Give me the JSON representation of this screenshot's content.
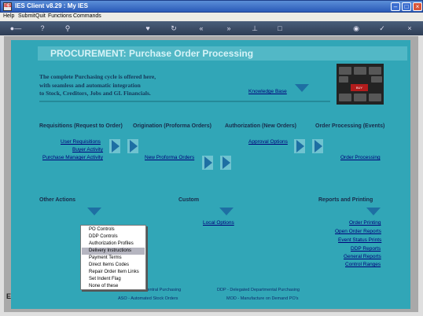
{
  "window": {
    "title": "IES Client v8.29 : My IES",
    "app_icon": "IES"
  },
  "menubar": [
    "Help",
    "Submit",
    "Quit",
    "Functions",
    "Commands"
  ],
  "toolbar_icons": [
    "key-icon",
    "help-icon",
    "search-icon",
    "heart-icon",
    "refresh-icon",
    "rewind-icon",
    "forward-icon",
    "pin-icon",
    "stop-icon",
    "globe-icon",
    "check-icon",
    "close-icon"
  ],
  "banner": {
    "title": "PROCUREMENT: Purchase Order Processing"
  },
  "intro": [
    "The complete Purchasing cycle is offered here,",
    "with seamless and automatic integration",
    "to Stock, Creditors, Jobs and GL Financials."
  ],
  "knowledge_base": "Knowledge Base",
  "photo": {
    "key_label": "BUY"
  },
  "sections": {
    "requisitions": {
      "heading": "Requisitions (Request to Order)",
      "links": [
        "User Requisitions",
        "Buyer Activity",
        "Purchase Manager Activity"
      ]
    },
    "origination": {
      "heading": "Origination (Proforma Orders)",
      "links": [
        "New Proforma Orders"
      ]
    },
    "authorization": {
      "heading": "Authorization (New Orders)",
      "links": [
        "Approval Options"
      ]
    },
    "processing": {
      "heading": "Order Processing (Events)",
      "links": [
        "Order Processing"
      ]
    },
    "other": {
      "heading": "Other Actions"
    },
    "custom": {
      "heading": "Custom",
      "links": [
        "Local Options"
      ]
    },
    "reports": {
      "heading": "Reports and Printing",
      "links": [
        "Order Printing",
        "Open Order Reports",
        "Event Status Prints",
        "DDP Reports",
        "General Reports",
        "Control Ranges"
      ]
    }
  },
  "dropdown": {
    "items": [
      "PO Controls",
      "DDP Controls",
      "Authorization Profiles",
      "Delivery Instructions",
      "Payment Terms",
      "Direct Items Codes",
      "Repair Order Item Links",
      "Set Indent Flag",
      "None of these"
    ],
    "selected": "Delivery Instructions"
  },
  "legend": [
    "CP - Central Purchasing",
    "DDP - Delegated Departmental Purchasing",
    "ASO - Automated Stock Orders",
    "MOD - Manufacture on Demand PO's"
  ],
  "status_letter": "E"
}
